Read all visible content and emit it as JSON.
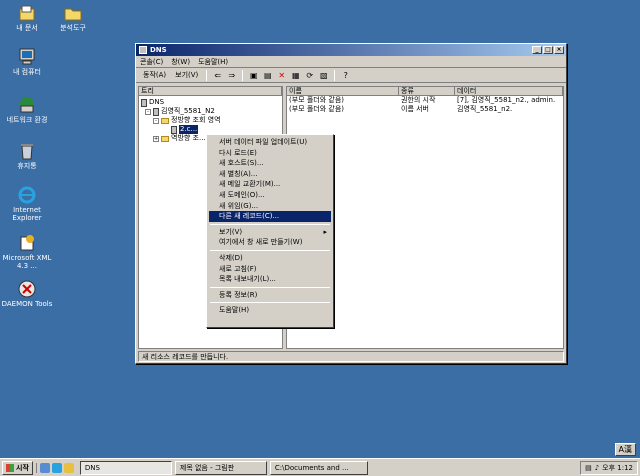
{
  "desktop": {
    "icons": [
      {
        "label": "내 문서",
        "icon": "my-documents-icon"
      },
      {
        "label": "분석도구",
        "icon": "folder-icon"
      },
      {
        "label": "내 컴퓨터",
        "icon": "my-computer-icon"
      },
      {
        "label": "네트워크 환경",
        "icon": "network-icon"
      },
      {
        "label": "휴지통",
        "icon": "recycle-bin-icon"
      },
      {
        "label": "Internet Explorer",
        "icon": "ie-icon"
      },
      {
        "label": "Microsoft XML 4.3 ...",
        "icon": "msxml-icon"
      },
      {
        "label": "DAEMON Tools",
        "icon": "daemon-tools-icon"
      }
    ]
  },
  "window": {
    "title": "DNS",
    "menus": [
      "콘솔(C)",
      "창(W)",
      "도움말(H)"
    ],
    "toolbar": {
      "action": "동작(A)",
      "view": "보기(V)"
    },
    "tree": {
      "header": "트리",
      "nodes": [
        "DNS",
        "김영직_5581_N2",
        "정방향 조회 영역",
        "2.c...",
        "역방향 조..."
      ]
    },
    "list": {
      "columns": [
        "이름",
        "종류",
        "데이터"
      ],
      "rows": [
        [
          "(부모 폴더와 같음)",
          "권한의 시작",
          "[7], 김영직_5581_n2., admin."
        ],
        [
          "(부모 폴더와 같음)",
          "이름 서버",
          "김영직_5581_n2."
        ]
      ]
    },
    "status": "새 리소스 레코드를 만듭니다."
  },
  "context_menu": {
    "items": [
      {
        "label": "서버 데이터 파일 업데이트(U)"
      },
      {
        "label": "다시 로드(E)"
      },
      {
        "label": "새 호스트(S)..."
      },
      {
        "label": "새 별칭(A)..."
      },
      {
        "label": "새 메일 교환기(M)..."
      },
      {
        "label": "새 도메인(O)..."
      },
      {
        "label": "새 위임(G)..."
      },
      {
        "label": "다른 새 레코드(C)...",
        "selected": true
      },
      {
        "sep": true
      },
      {
        "label": "보기(V)",
        "submenu": true
      },
      {
        "label": "여기에서 창 새로 만들기(W)"
      },
      {
        "sep": true
      },
      {
        "label": "삭제(D)"
      },
      {
        "label": "새로 고침(F)"
      },
      {
        "label": "목록 내보내기(L)..."
      },
      {
        "sep": true
      },
      {
        "label": "등록 정보(R)"
      },
      {
        "sep": true
      },
      {
        "label": "도움말(H)"
      }
    ]
  },
  "taskbar": {
    "start": "시작",
    "tasks": [
      "DNS",
      "제목 없음 - 그림판",
      "C:\\Documents and ..."
    ],
    "clock": "오후 1:12"
  },
  "ime": "A漢"
}
